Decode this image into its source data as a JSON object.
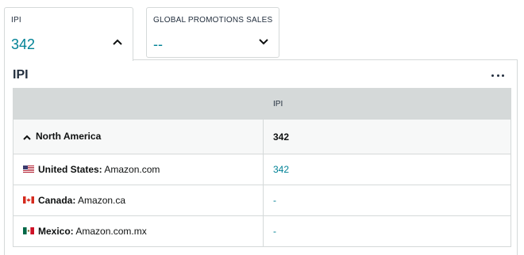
{
  "metrics": {
    "ipi": {
      "label": "IPI",
      "value": "342"
    },
    "promo": {
      "label": "GLOBAL PROMOTIONS SALES",
      "value": "--"
    }
  },
  "panel": {
    "title": "IPI",
    "column_header": "IPI",
    "region": {
      "name": "North America",
      "value": "342"
    },
    "rows": [
      {
        "country": "United States:",
        "marketplace": "Amazon.com",
        "value": "342",
        "flag": "us-flag-icon"
      },
      {
        "country": "Canada:",
        "marketplace": "Amazon.ca",
        "value": "-",
        "flag": "ca-flag-icon"
      },
      {
        "country": "Mexico:",
        "marketplace": "Amazon.com.mx",
        "value": "-",
        "flag": "mx-flag-icon"
      }
    ]
  },
  "colors": {
    "accent": "#008296",
    "header_bg": "#d5d9d9",
    "border": "#d5d9d9"
  }
}
